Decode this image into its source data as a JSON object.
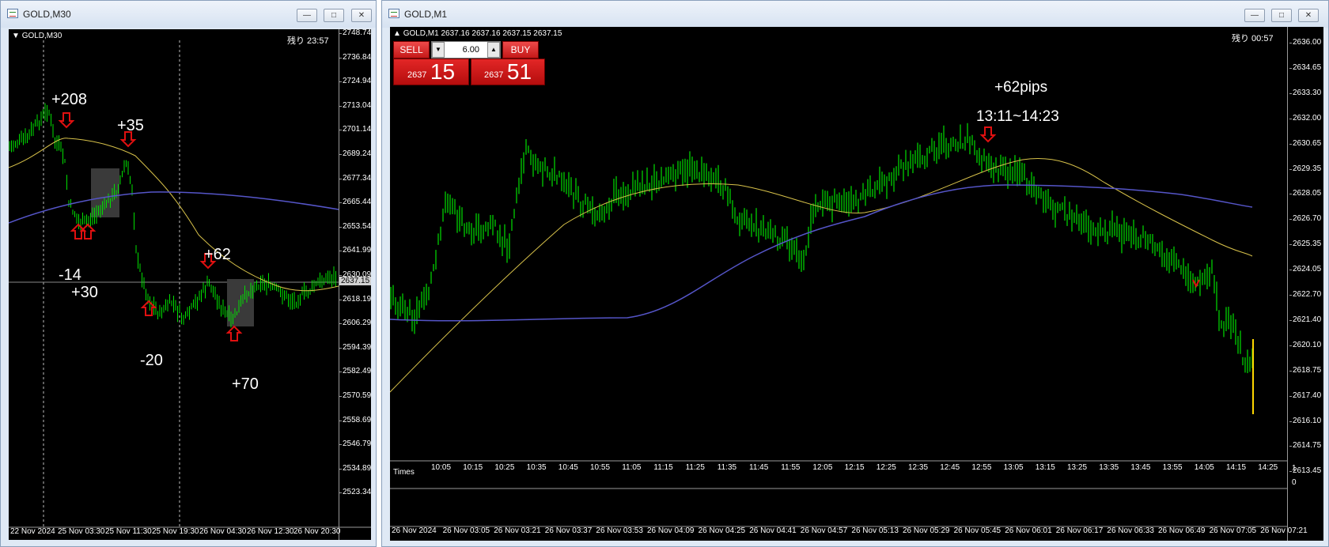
{
  "left_window": {
    "title": "GOLD,M30",
    "chart_header": "GOLD,M30",
    "timer": "残り 23:57",
    "current_price": "2637.15",
    "y_labels": [
      "2748.74",
      "2736.84",
      "2724.94",
      "2713.04",
      "2701.14",
      "2689.24",
      "2677.34",
      "2665.44",
      "2653.54",
      "2641.99",
      "2630.09",
      "2618.19",
      "2606.29",
      "2594.39",
      "2582.49",
      "2570.59",
      "2558.69",
      "2546.79",
      "2534.89",
      "2523.34"
    ],
    "x_labels": [
      "22 Nov 2024",
      "25 Nov 03:30",
      "25 Nov 11:30",
      "25 Nov 19:30",
      "26 Nov 04:30",
      "26 Nov 12:30",
      "26 Nov 20:30"
    ],
    "annotations": [
      "+208",
      "+35",
      "-14",
      "+30",
      "+62",
      "-20",
      "+70"
    ]
  },
  "right_window": {
    "title": "GOLD,M1",
    "chart_header": "GOLD,M1  2637.16  2637.16  2637.15  2637.15",
    "timer": "残り 00:57",
    "trade_panel": {
      "sell_label": "SELL",
      "buy_label": "BUY",
      "lot_value": "6.00",
      "sell_price_small": "2637",
      "sell_price_big": "15",
      "buy_price_small": "2637",
      "buy_price_big": "51"
    },
    "annotation_pips": "+62pips",
    "annotation_time": "13:11~14:23",
    "y_labels": [
      "2636.00",
      "2634.65",
      "2633.30",
      "2632.00",
      "2630.65",
      "2629.35",
      "2628.05",
      "2626.70",
      "2625.35",
      "2624.05",
      "2622.70",
      "2621.40",
      "2620.10",
      "2618.75",
      "2617.40",
      "2616.10",
      "2614.75",
      "2613.45"
    ],
    "time_labels": [
      "10:05",
      "10:15",
      "10:25",
      "10:35",
      "10:45",
      "10:55",
      "11:05",
      "11:15",
      "11:25",
      "11:35",
      "11:45",
      "11:55",
      "12:05",
      "12:15",
      "12:25",
      "12:35",
      "12:45",
      "12:55",
      "13:05",
      "13:15",
      "13:25",
      "13:35",
      "13:45",
      "13:55",
      "14:05",
      "14:15",
      "14:25"
    ],
    "times_label": "Times",
    "indicator_scale": [
      "1",
      "0"
    ],
    "x_labels": [
      "26 Nov 2024",
      "26 Nov 03:05",
      "26 Nov 03:21",
      "26 Nov 03:37",
      "26 Nov 03:53",
      "26 Nov 04:09",
      "26 Nov 04:25",
      "26 Nov 04:41",
      "26 Nov 04:57",
      "26 Nov 05:13",
      "26 Nov 05:29",
      "26 Nov 05:45",
      "26 Nov 06:01",
      "26 Nov 06:17",
      "26 Nov 06:33",
      "26 Nov 06:49",
      "26 Nov 07:05",
      "26 Nov 07:21"
    ]
  },
  "colors": {
    "bull": "#00e000",
    "ma_yellow": "#d8c24a",
    "ma_blue": "#5555c8",
    "arrow": "#e01010"
  }
}
